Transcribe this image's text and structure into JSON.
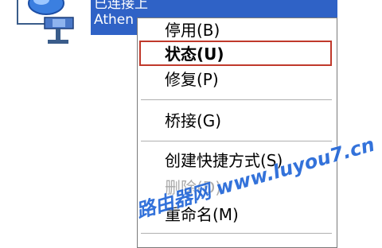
{
  "connection": {
    "status_text": "已连接上",
    "adapter_text": "Athen"
  },
  "menu": {
    "items": [
      {
        "label": "停用(B)"
      },
      {
        "label": "状态(U)"
      },
      {
        "label": "修复(P)"
      },
      {
        "label": "桥接(G)"
      },
      {
        "label": "创建快捷方式(S)"
      },
      {
        "label": "删除(D)"
      },
      {
        "label": "重命名(M)"
      }
    ]
  },
  "watermark": "路由器网 www.luyou7.cn",
  "colors": {
    "selection": "#2f62c6",
    "highlight_box": "#c0392b",
    "watermark": "#1e63d6"
  }
}
